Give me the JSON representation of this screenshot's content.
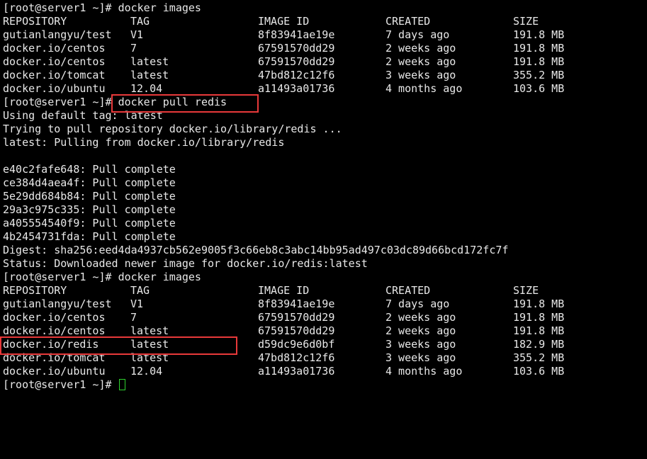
{
  "prompt": "[root@server1 ~]#",
  "commands": {
    "images1": "docker images",
    "pull": "docker pull redis",
    "images2": "docker images"
  },
  "header": {
    "repository": "REPOSITORY",
    "tag": "TAG",
    "image_id": "IMAGE ID",
    "created": "CREATED",
    "size": "SIZE"
  },
  "table1": [
    {
      "repo": "gutianlangyu/test",
      "tag": "V1",
      "id": "8f83941ae19e",
      "created": "7 days ago",
      "size": "191.8 MB"
    },
    {
      "repo": "docker.io/centos",
      "tag": "7",
      "id": "67591570dd29",
      "created": "2 weeks ago",
      "size": "191.8 MB"
    },
    {
      "repo": "docker.io/centos",
      "tag": "latest",
      "id": "67591570dd29",
      "created": "2 weeks ago",
      "size": "191.8 MB"
    },
    {
      "repo": "docker.io/tomcat",
      "tag": "latest",
      "id": "47bd812c12f6",
      "created": "3 weeks ago",
      "size": "355.2 MB"
    },
    {
      "repo": "docker.io/ubuntu",
      "tag": "12.04",
      "id": "a11493a01736",
      "created": "4 months ago",
      "size": "103.6 MB"
    }
  ],
  "pull_output": {
    "default_tag": "Using default tag: latest",
    "trying": "Trying to pull repository docker.io/library/redis ...",
    "pulling": "latest: Pulling from docker.io/library/redis",
    "layers": [
      "e40c2fafe648: Pull complete",
      "ce384d4aea4f: Pull complete",
      "5e29dd684b84: Pull complete",
      "29a3c975c335: Pull complete",
      "a405554540f9: Pull complete",
      "4b2454731fda: Pull complete"
    ],
    "digest": "Digest: sha256:eed4da4937cb562e9005f3c66eb8c3abc14bb95ad497c03dc89d66bcd172fc7f",
    "status": "Status: Downloaded newer image for docker.io/redis:latest"
  },
  "table2": [
    {
      "repo": "gutianlangyu/test",
      "tag": "V1",
      "id": "8f83941ae19e",
      "created": "7 days ago",
      "size": "191.8 MB"
    },
    {
      "repo": "docker.io/centos",
      "tag": "7",
      "id": "67591570dd29",
      "created": "2 weeks ago",
      "size": "191.8 MB"
    },
    {
      "repo": "docker.io/centos",
      "tag": "latest",
      "id": "67591570dd29",
      "created": "2 weeks ago",
      "size": "191.8 MB"
    },
    {
      "repo": "docker.io/redis",
      "tag": "latest",
      "id": "d59dc9e6d0bf",
      "created": "3 weeks ago",
      "size": "182.9 MB"
    },
    {
      "repo": "docker.io/tomcat",
      "tag": "latest",
      "id": "47bd812c12f6",
      "created": "3 weeks ago",
      "size": "355.2 MB"
    },
    {
      "repo": "docker.io/ubuntu",
      "tag": "12.04",
      "id": "a11493a01736",
      "created": "4 months ago",
      "size": "103.6 MB"
    }
  ],
  "colors": {
    "background": "#000000",
    "text": "#e8e8e8",
    "highlight": "#e8393a",
    "cursor": "#2fd12f"
  }
}
